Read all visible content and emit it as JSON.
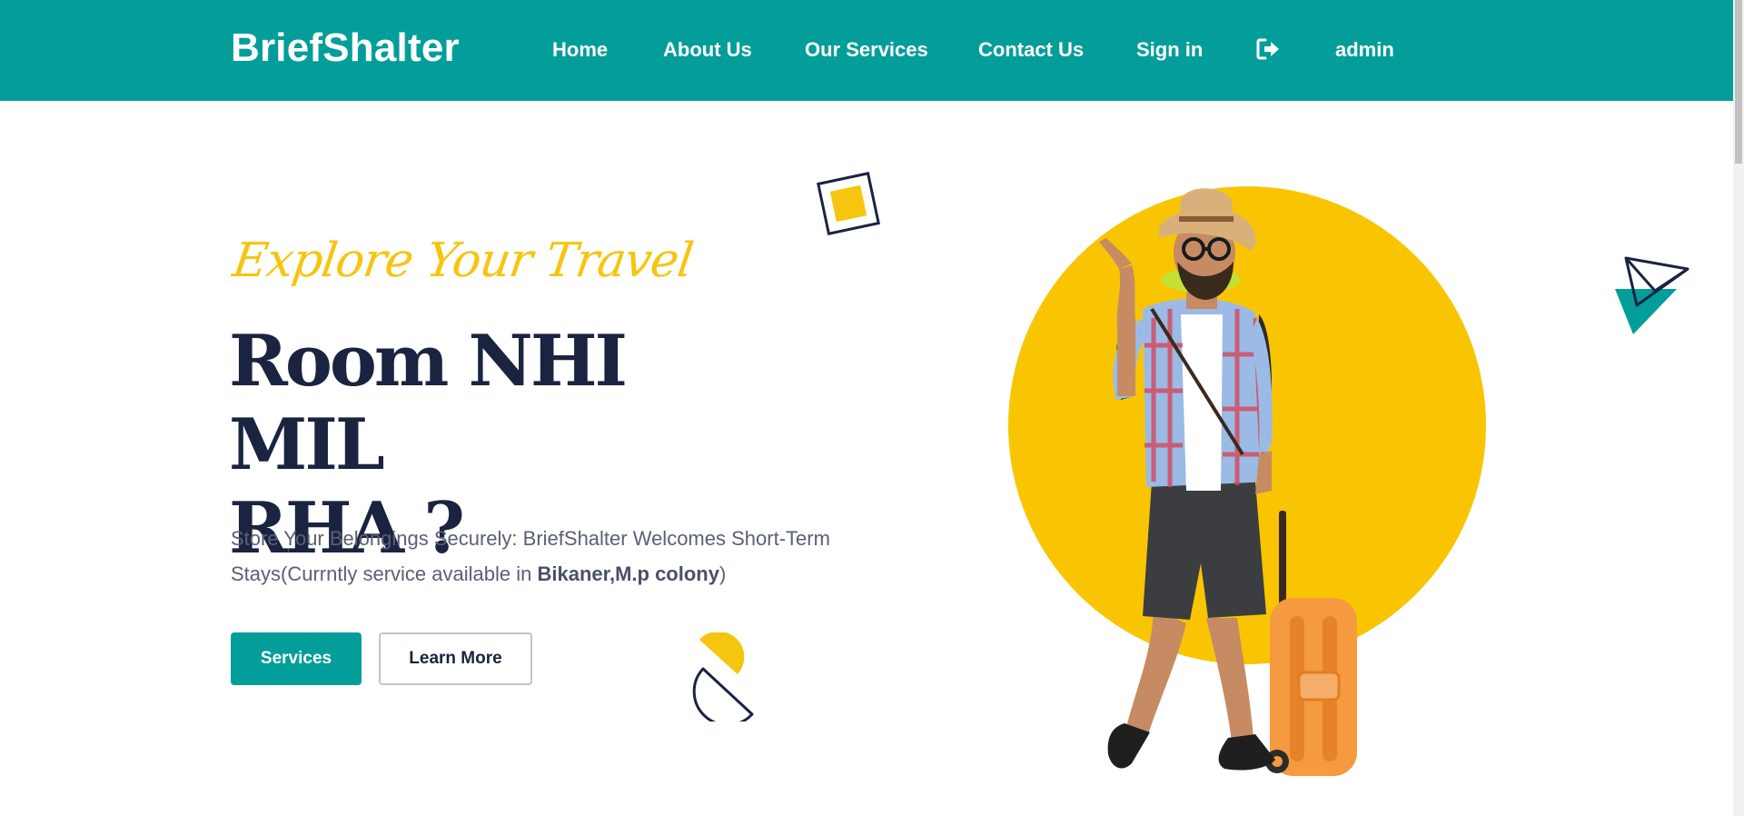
{
  "header": {
    "brand": "BriefShalter",
    "nav": [
      {
        "label": "Home"
      },
      {
        "label": "About Us"
      },
      {
        "label": "Our Services"
      },
      {
        "label": "Contact Us"
      },
      {
        "label": "Sign in"
      }
    ],
    "logout_icon": "sign-out-icon",
    "user_label": "admin"
  },
  "hero": {
    "tagline": "Explore Your Travel",
    "headline_line1": "Room NHI MIL",
    "headline_line2": "RHA ?",
    "description_prefix": "Store Your Belongings Securely: BriefShalter Welcomes Short-Term Stays(Currntly service available in ",
    "description_location": "Bikaner,M.p colony",
    "description_suffix": ")",
    "primary_button": "Services",
    "secondary_button": "Learn More"
  },
  "colors": {
    "brand": "#049e9a",
    "accent": "#f6c50f",
    "heading": "#1a2340"
  }
}
